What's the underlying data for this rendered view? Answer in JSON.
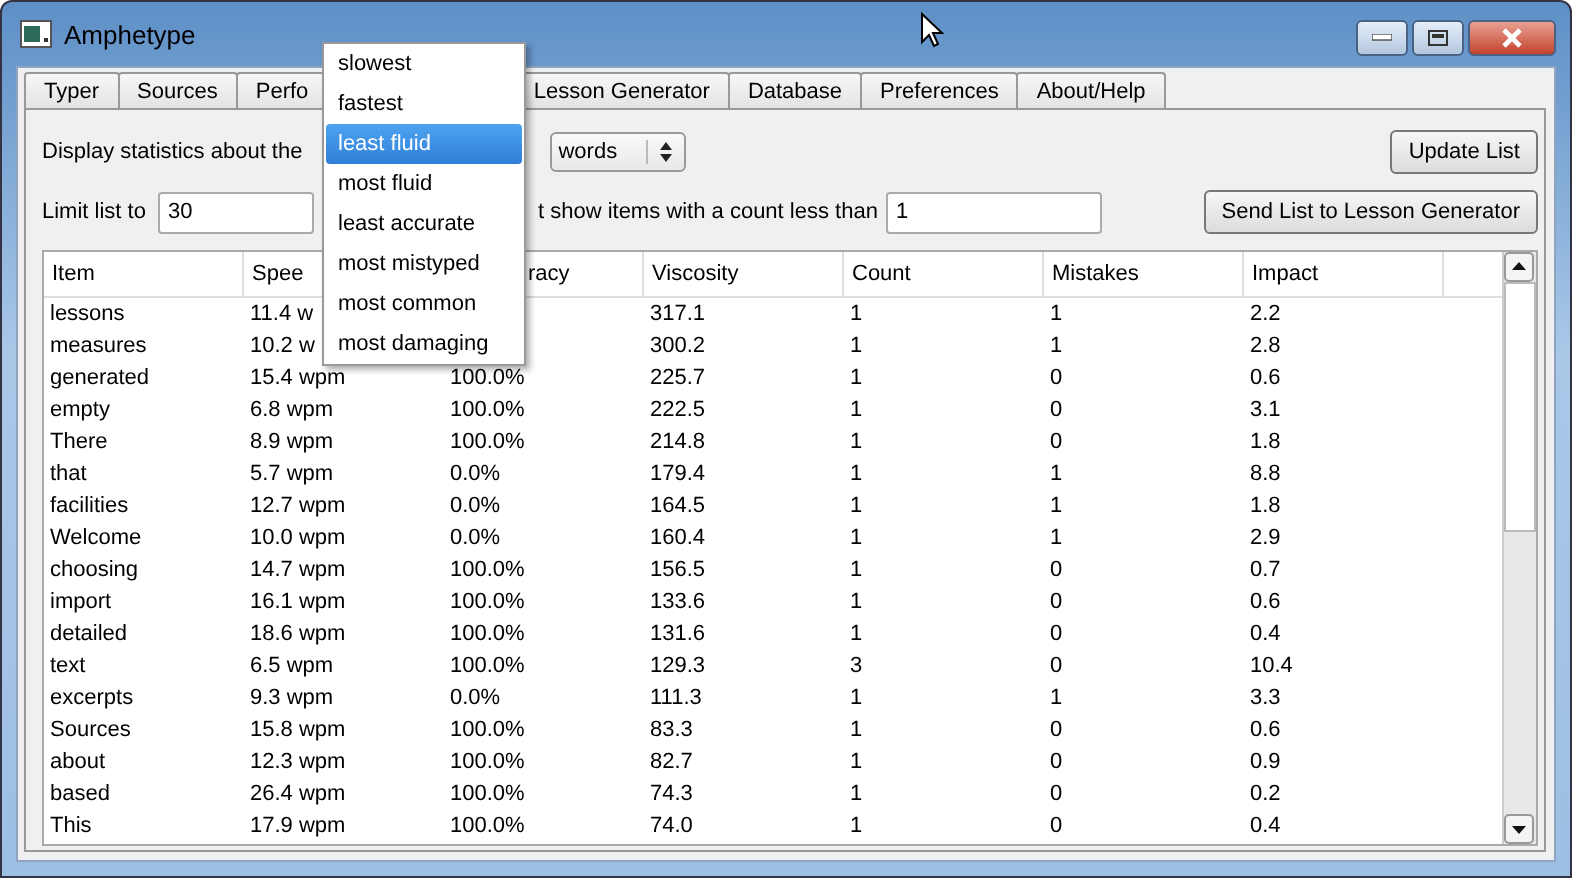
{
  "window": {
    "title": "Amphetype"
  },
  "tabs": [
    {
      "label": "Typer",
      "selected": false
    },
    {
      "label": "Sources",
      "selected": false
    },
    {
      "label": "Perfo",
      "selected": false
    },
    {
      "label": "Lesson Generator",
      "selected": false
    },
    {
      "label": "Database",
      "selected": false
    },
    {
      "label": "Preferences",
      "selected": false
    },
    {
      "label": "About/Help",
      "selected": false
    }
  ],
  "controls": {
    "display_label": "Display statistics about the",
    "unit_combo": "words",
    "update_button": "Update List",
    "limit_label": "Limit list to",
    "limit_value": "30",
    "min_count_label": "t show items with a count less than",
    "min_count_value": "1",
    "send_button": "Send List to Lesson Generator"
  },
  "dropdown": {
    "items": [
      {
        "label": "slowest",
        "selected": false
      },
      {
        "label": "fastest",
        "selected": false
      },
      {
        "label": "least fluid",
        "selected": true
      },
      {
        "label": "most fluid",
        "selected": false
      },
      {
        "label": "least accurate",
        "selected": false
      },
      {
        "label": "most mistyped",
        "selected": false
      },
      {
        "label": "most common",
        "selected": false
      },
      {
        "label": "most damaging",
        "selected": false
      }
    ]
  },
  "table": {
    "columns": [
      "Item",
      "Spee",
      "racy",
      "Viscosity",
      "Count",
      "Mistakes",
      "Impact"
    ],
    "rows": [
      {
        "item": "lessons",
        "speed": "11.4 w",
        "viscosity": "317.1",
        "count": "1",
        "mistakes": "1",
        "impact": "2.2"
      },
      {
        "item": "measures",
        "speed": "10.2 w",
        "viscosity": "300.2",
        "count": "1",
        "mistakes": "1",
        "impact": "2.8"
      },
      {
        "item": "generated",
        "speed": "15.4 wpm",
        "accuracy": "100.0%",
        "viscosity": "225.7",
        "count": "1",
        "mistakes": "0",
        "impact": "0.6"
      },
      {
        "item": "empty",
        "speed": "6.8 wpm",
        "accuracy": "100.0%",
        "viscosity": "222.5",
        "count": "1",
        "mistakes": "0",
        "impact": "3.1"
      },
      {
        "item": "There",
        "speed": "8.9 wpm",
        "accuracy": "100.0%",
        "viscosity": "214.8",
        "count": "1",
        "mistakes": "0",
        "impact": "1.8"
      },
      {
        "item": "that",
        "speed": "5.7 wpm",
        "accuracy": "0.0%",
        "viscosity": "179.4",
        "count": "1",
        "mistakes": "1",
        "impact": "8.8"
      },
      {
        "item": "facilities",
        "speed": "12.7 wpm",
        "accuracy": "0.0%",
        "viscosity": "164.5",
        "count": "1",
        "mistakes": "1",
        "impact": "1.8"
      },
      {
        "item": "Welcome",
        "speed": "10.0 wpm",
        "accuracy": "0.0%",
        "viscosity": "160.4",
        "count": "1",
        "mistakes": "1",
        "impact": "2.9"
      },
      {
        "item": "choosing",
        "speed": "14.7 wpm",
        "accuracy": "100.0%",
        "viscosity": "156.5",
        "count": "1",
        "mistakes": "0",
        "impact": "0.7"
      },
      {
        "item": "import",
        "speed": "16.1 wpm",
        "accuracy": "100.0%",
        "viscosity": "133.6",
        "count": "1",
        "mistakes": "0",
        "impact": "0.6"
      },
      {
        "item": "detailed",
        "speed": "18.6 wpm",
        "accuracy": "100.0%",
        "viscosity": "131.6",
        "count": "1",
        "mistakes": "0",
        "impact": "0.4"
      },
      {
        "item": "text",
        "speed": "6.5 wpm",
        "accuracy": "100.0%",
        "viscosity": "129.3",
        "count": "3",
        "mistakes": "0",
        "impact": "10.4"
      },
      {
        "item": "excerpts",
        "speed": "9.3 wpm",
        "accuracy": "0.0%",
        "viscosity": "111.3",
        "count": "1",
        "mistakes": "1",
        "impact": "3.3"
      },
      {
        "item": "Sources",
        "speed": "15.8 wpm",
        "accuracy": "100.0%",
        "viscosity": "83.3",
        "count": "1",
        "mistakes": "0",
        "impact": "0.6"
      },
      {
        "item": "about",
        "speed": "12.3 wpm",
        "accuracy": "100.0%",
        "viscosity": "82.7",
        "count": "1",
        "mistakes": "0",
        "impact": "0.9"
      },
      {
        "item": "based",
        "speed": "26.4 wpm",
        "accuracy": "100.0%",
        "viscosity": "74.3",
        "count": "1",
        "mistakes": "0",
        "impact": "0.2"
      },
      {
        "item": "This",
        "speed": "17.9 wpm",
        "accuracy": "100.0%",
        "viscosity": "74.0",
        "count": "1",
        "mistakes": "0",
        "impact": "0.4"
      }
    ]
  }
}
